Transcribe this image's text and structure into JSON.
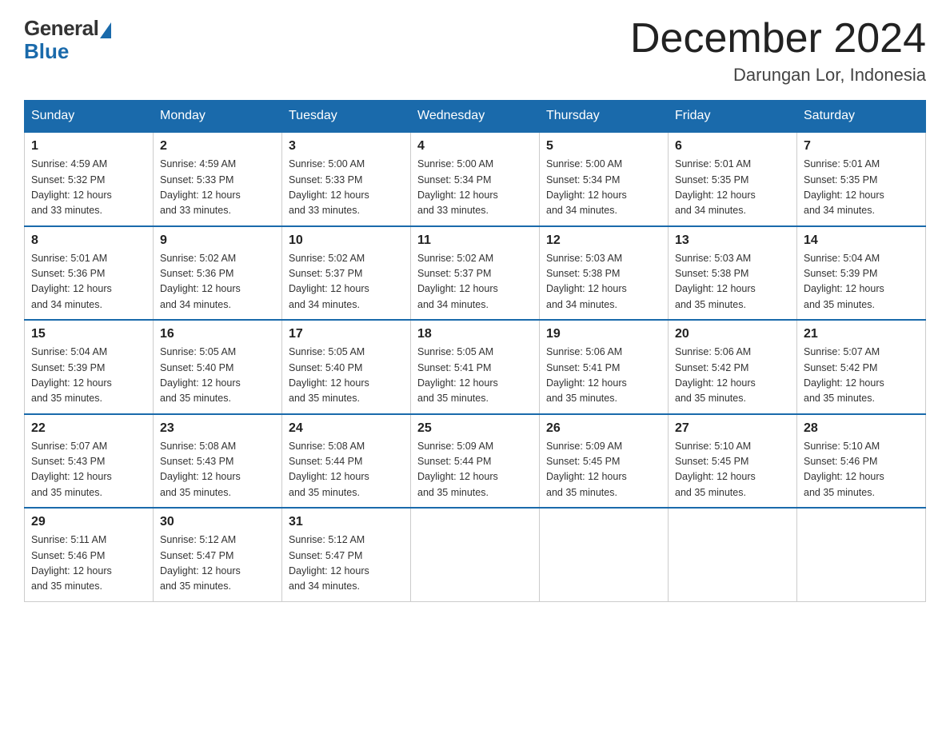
{
  "header": {
    "logo_general": "General",
    "logo_blue": "Blue",
    "main_title": "December 2024",
    "subtitle": "Darungan Lor, Indonesia"
  },
  "days_of_week": [
    "Sunday",
    "Monday",
    "Tuesday",
    "Wednesday",
    "Thursday",
    "Friday",
    "Saturday"
  ],
  "weeks": [
    [
      {
        "day": "1",
        "sunrise": "4:59 AM",
        "sunset": "5:32 PM",
        "daylight": "12 hours and 33 minutes."
      },
      {
        "day": "2",
        "sunrise": "4:59 AM",
        "sunset": "5:33 PM",
        "daylight": "12 hours and 33 minutes."
      },
      {
        "day": "3",
        "sunrise": "5:00 AM",
        "sunset": "5:33 PM",
        "daylight": "12 hours and 33 minutes."
      },
      {
        "day": "4",
        "sunrise": "5:00 AM",
        "sunset": "5:34 PM",
        "daylight": "12 hours and 33 minutes."
      },
      {
        "day": "5",
        "sunrise": "5:00 AM",
        "sunset": "5:34 PM",
        "daylight": "12 hours and 34 minutes."
      },
      {
        "day": "6",
        "sunrise": "5:01 AM",
        "sunset": "5:35 PM",
        "daylight": "12 hours and 34 minutes."
      },
      {
        "day": "7",
        "sunrise": "5:01 AM",
        "sunset": "5:35 PM",
        "daylight": "12 hours and 34 minutes."
      }
    ],
    [
      {
        "day": "8",
        "sunrise": "5:01 AM",
        "sunset": "5:36 PM",
        "daylight": "12 hours and 34 minutes."
      },
      {
        "day": "9",
        "sunrise": "5:02 AM",
        "sunset": "5:36 PM",
        "daylight": "12 hours and 34 minutes."
      },
      {
        "day": "10",
        "sunrise": "5:02 AM",
        "sunset": "5:37 PM",
        "daylight": "12 hours and 34 minutes."
      },
      {
        "day": "11",
        "sunrise": "5:02 AM",
        "sunset": "5:37 PM",
        "daylight": "12 hours and 34 minutes."
      },
      {
        "day": "12",
        "sunrise": "5:03 AM",
        "sunset": "5:38 PM",
        "daylight": "12 hours and 34 minutes."
      },
      {
        "day": "13",
        "sunrise": "5:03 AM",
        "sunset": "5:38 PM",
        "daylight": "12 hours and 35 minutes."
      },
      {
        "day": "14",
        "sunrise": "5:04 AM",
        "sunset": "5:39 PM",
        "daylight": "12 hours and 35 minutes."
      }
    ],
    [
      {
        "day": "15",
        "sunrise": "5:04 AM",
        "sunset": "5:39 PM",
        "daylight": "12 hours and 35 minutes."
      },
      {
        "day": "16",
        "sunrise": "5:05 AM",
        "sunset": "5:40 PM",
        "daylight": "12 hours and 35 minutes."
      },
      {
        "day": "17",
        "sunrise": "5:05 AM",
        "sunset": "5:40 PM",
        "daylight": "12 hours and 35 minutes."
      },
      {
        "day": "18",
        "sunrise": "5:05 AM",
        "sunset": "5:41 PM",
        "daylight": "12 hours and 35 minutes."
      },
      {
        "day": "19",
        "sunrise": "5:06 AM",
        "sunset": "5:41 PM",
        "daylight": "12 hours and 35 minutes."
      },
      {
        "day": "20",
        "sunrise": "5:06 AM",
        "sunset": "5:42 PM",
        "daylight": "12 hours and 35 minutes."
      },
      {
        "day": "21",
        "sunrise": "5:07 AM",
        "sunset": "5:42 PM",
        "daylight": "12 hours and 35 minutes."
      }
    ],
    [
      {
        "day": "22",
        "sunrise": "5:07 AM",
        "sunset": "5:43 PM",
        "daylight": "12 hours and 35 minutes."
      },
      {
        "day": "23",
        "sunrise": "5:08 AM",
        "sunset": "5:43 PM",
        "daylight": "12 hours and 35 minutes."
      },
      {
        "day": "24",
        "sunrise": "5:08 AM",
        "sunset": "5:44 PM",
        "daylight": "12 hours and 35 minutes."
      },
      {
        "day": "25",
        "sunrise": "5:09 AM",
        "sunset": "5:44 PM",
        "daylight": "12 hours and 35 minutes."
      },
      {
        "day": "26",
        "sunrise": "5:09 AM",
        "sunset": "5:45 PM",
        "daylight": "12 hours and 35 minutes."
      },
      {
        "day": "27",
        "sunrise": "5:10 AM",
        "sunset": "5:45 PM",
        "daylight": "12 hours and 35 minutes."
      },
      {
        "day": "28",
        "sunrise": "5:10 AM",
        "sunset": "5:46 PM",
        "daylight": "12 hours and 35 minutes."
      }
    ],
    [
      {
        "day": "29",
        "sunrise": "5:11 AM",
        "sunset": "5:46 PM",
        "daylight": "12 hours and 35 minutes."
      },
      {
        "day": "30",
        "sunrise": "5:12 AM",
        "sunset": "5:47 PM",
        "daylight": "12 hours and 35 minutes."
      },
      {
        "day": "31",
        "sunrise": "5:12 AM",
        "sunset": "5:47 PM",
        "daylight": "12 hours and 34 minutes."
      },
      null,
      null,
      null,
      null
    ]
  ]
}
